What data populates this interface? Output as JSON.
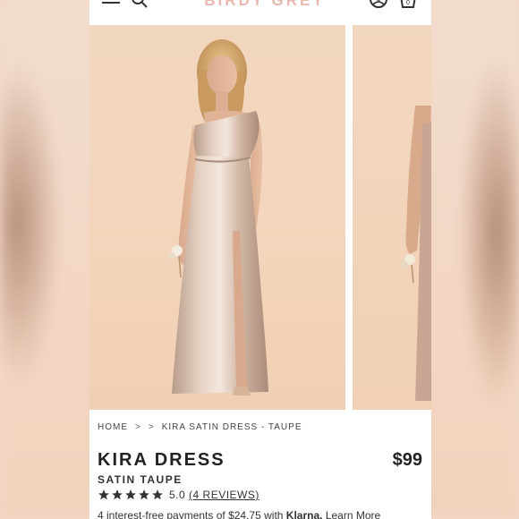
{
  "header": {
    "brand": "BIRDY GREY",
    "cart_count": "0"
  },
  "gallery": {
    "main_image": "model wearing one-shoulder satin gown",
    "next_image": "model side view"
  },
  "breadcrumb": {
    "home": "HOME",
    "sep1": ">",
    "sep2": ">",
    "current": "KIRA SATIN DRESS - TAUPE"
  },
  "product": {
    "title": "KIRA DRESS",
    "subtitle": "SATIN TAUPE",
    "price": "$99",
    "rating": "5.0",
    "reviews": "(4 REVIEWS)",
    "stars": 5
  },
  "klarna": {
    "prefix": "4 interest-free payments of $24.75 with",
    "brand": "Klarna.",
    "link": "Learn More"
  },
  "colors": {
    "brand": "#e9b8b0",
    "text": "#222222",
    "background": "#f3d9c8"
  }
}
